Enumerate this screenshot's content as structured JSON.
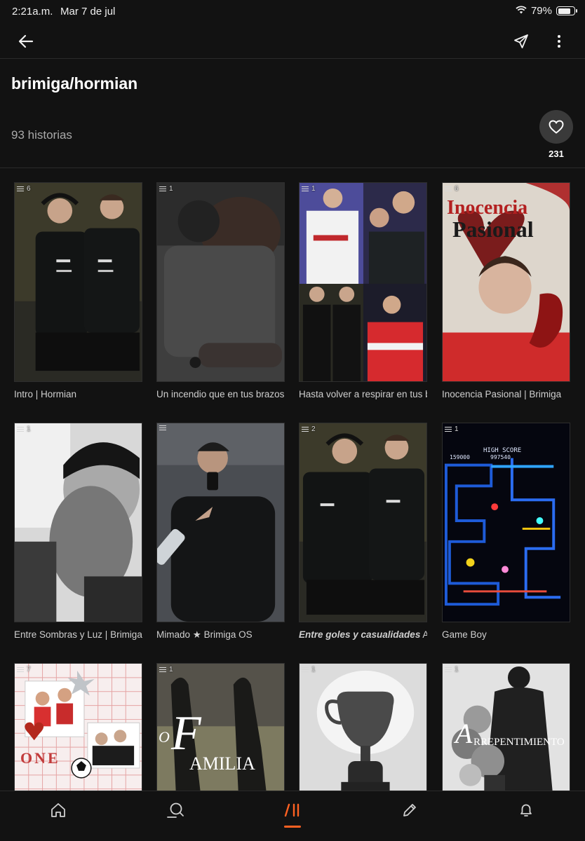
{
  "status_bar": {
    "time": "2:21a.m.",
    "date": "Mar 7 de jul",
    "battery": "79%",
    "battery_level": 0.79
  },
  "header": {
    "title": "brimiga/hormian",
    "story_count": "93 historias",
    "likes": "231"
  },
  "stories": [
    {
      "parts": "6",
      "title": "Intro | Hormian"
    },
    {
      "parts": "1",
      "title": "Un incendio que en tus brazos se"
    },
    {
      "parts": "1",
      "title": "Hasta volver a respirar en tus b"
    },
    {
      "parts": "6",
      "title": "Inocencia Pasional | Brimiga",
      "cover_title_1": "Inocencia",
      "cover_title_2": "Pasional"
    },
    {
      "parts": "1",
      "title": "Entre Sombras y Luz | Brimiga"
    },
    {
      "parts": "",
      "title": "Mimado ★ Brimiga OS"
    },
    {
      "parts": "2",
      "title_italic": "Entre goles y casualidades",
      "title_rest": " Arm"
    },
    {
      "parts": "1",
      "title": "Game Boy",
      "cover_score_label": "HIGH SCORE",
      "cover_score_1": "159000",
      "cover_score_2": "997540"
    },
    {
      "parts": "7",
      "title": "",
      "cover_text": "ONE"
    },
    {
      "parts": "1",
      "title": "",
      "cover_text_1": "O",
      "cover_text_2": "F",
      "cover_text_3": "AMILIA"
    },
    {
      "parts": "1",
      "title": ""
    },
    {
      "parts": "1",
      "title": "",
      "cover_text_1": "A",
      "cover_text_2": "RREPENTIMIENTO"
    }
  ],
  "colors": {
    "accent": "#ff6122",
    "background": "#121212"
  },
  "icons": [
    "back-arrow-icon",
    "send-icon",
    "more-vertical-icon",
    "heart-icon",
    "home-icon",
    "search-icon",
    "library-icon",
    "pencil-icon",
    "bell-icon",
    "wifi-icon",
    "battery-icon",
    "list-icon"
  ]
}
